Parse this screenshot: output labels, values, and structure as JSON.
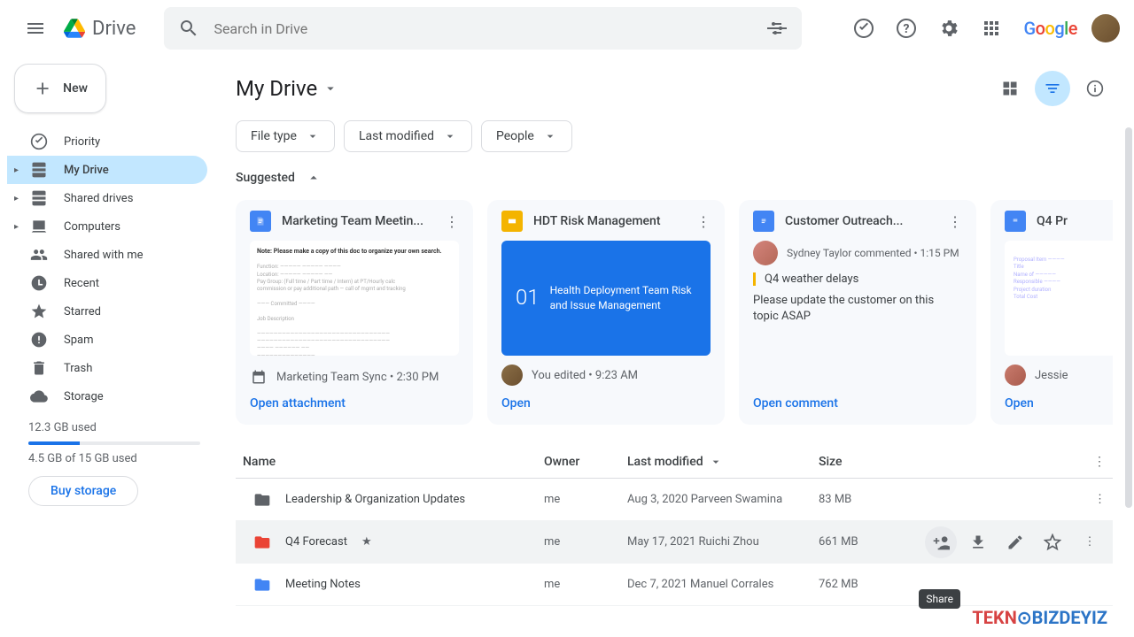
{
  "header": {
    "app_name": "Drive",
    "search_placeholder": "Search in Drive"
  },
  "sidebar": {
    "new_label": "New",
    "items": [
      {
        "label": "Priority"
      },
      {
        "label": "My Drive"
      },
      {
        "label": "Shared drives"
      },
      {
        "label": "Computers"
      },
      {
        "label": "Shared with me"
      },
      {
        "label": "Recent"
      },
      {
        "label": "Starred"
      },
      {
        "label": "Spam"
      },
      {
        "label": "Trash"
      },
      {
        "label": "Storage"
      }
    ],
    "storage_top": "12.3 GB used",
    "storage_text": "4.5 GB of 15 GB used",
    "buy_label": "Buy storage"
  },
  "main": {
    "breadcrumb": "My Drive",
    "chips": [
      "File type",
      "Last modified",
      "People"
    ],
    "suggested_label": "Suggested",
    "cards": [
      {
        "title": "Marketing Team Meetin...",
        "foot_text": "Marketing Team Sync • 2:30 PM",
        "action": "Open attachment"
      },
      {
        "title": "HDT Risk Management",
        "slide_num": "01",
        "slide_text": "Health Deployment Team Risk and Issue Management",
        "foot_text": "You edited • 9:23 AM",
        "action": "Open"
      },
      {
        "title": "Customer Outreach...",
        "comment_meta": "Sydney Taylor commented • 1:15 PM",
        "comment_quote": "Q4 weather delays",
        "comment_body": "Please update the customer on this topic ASAP",
        "action": "Open comment"
      },
      {
        "title": "Q4 Pr",
        "foot_text": "Jessie",
        "action": "Open"
      }
    ],
    "table": {
      "headers": {
        "name": "Name",
        "owner": "Owner",
        "modified": "Last modified",
        "size": "Size"
      },
      "rows": [
        {
          "name": "Leadership & Organization Updates",
          "owner": "me",
          "modified": "Aug 3, 2020 Parveen Swamina",
          "size": "83 MB"
        },
        {
          "name": "Q4 Forecast",
          "owner": "me",
          "modified": "May 17, 2021 Ruichi Zhou",
          "size": "661 MB"
        },
        {
          "name": "Meeting Notes",
          "owner": "me",
          "modified": "Dec 7, 2021 Manuel Corrales",
          "size": "762 MB"
        }
      ]
    },
    "tooltip": "Share"
  }
}
